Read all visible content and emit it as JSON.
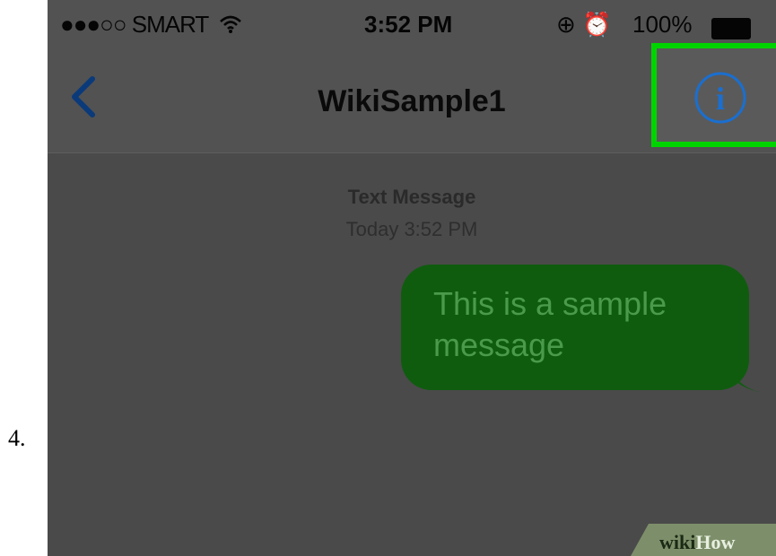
{
  "step": {
    "number": "4."
  },
  "status_bar": {
    "signal": "●●●○○ SMART",
    "wifi_icon": "wifi-icon",
    "time": "3:52 PM",
    "status_icons": "⊕ ⏰",
    "battery": "100%"
  },
  "nav": {
    "back_icon": "chevron-left-icon",
    "title": "WikiSample1",
    "info_icon": "info-icon",
    "highlight_color": "#00d400"
  },
  "conversation": {
    "label": "Text Message",
    "timestamp": "Today 3:52 PM",
    "messages": [
      {
        "text": "This is a sample message",
        "bubble_color": "#0f5c0f"
      }
    ]
  },
  "watermark": {
    "wiki": "wiki",
    "how": "How"
  }
}
